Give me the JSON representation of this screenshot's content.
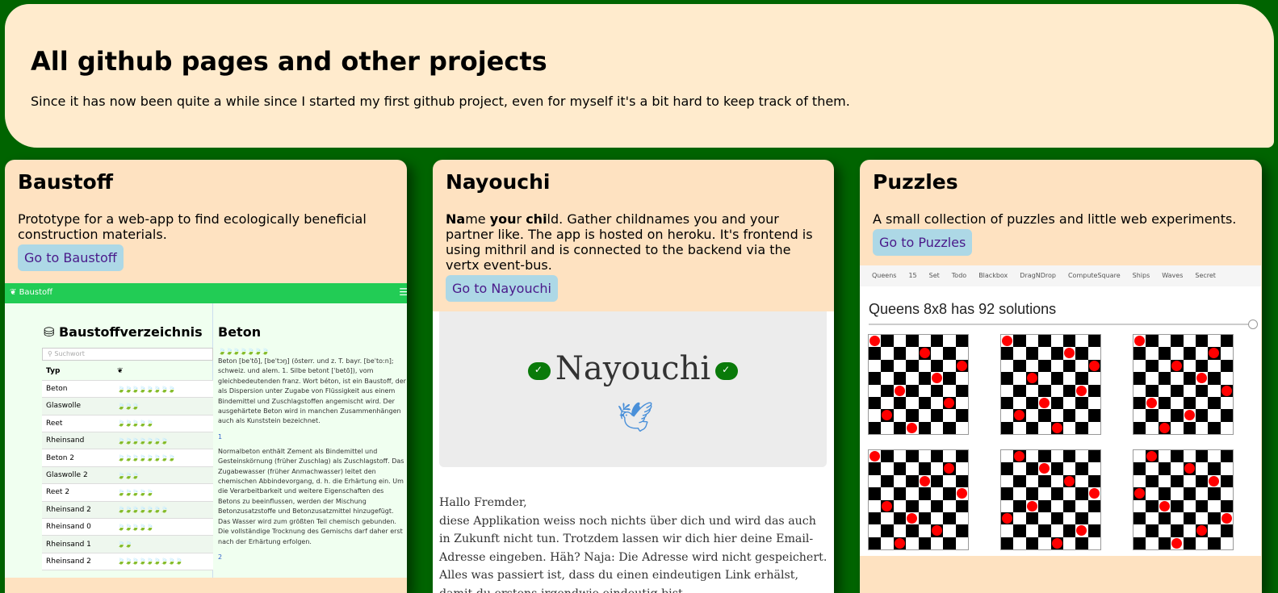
{
  "header": {
    "title": "All github pages and other projects",
    "subtitle": "Since it has now been quite a while since I started my first github project, even for myself it's a bit hard to keep track of them."
  },
  "cards": {
    "baustoff": {
      "title": "Baustoff",
      "description": "Prototype for a web-app to find ecologically beneficial construction materials.",
      "button": "Go to Baustoff",
      "preview": {
        "nav_title": "Baustoff",
        "heading": "Baustoffverzeichnis",
        "search_placeholder": "Suchwort",
        "col_type": "Typ",
        "rows": [
          {
            "name": "Beton",
            "leaves": "🍃🍃🍃🍃🍃🍃🍃🍃",
            "color": "#22aa33"
          },
          {
            "name": "Glaswolle",
            "leaves": "🍃🍃🍃",
            "color": "#ee3344"
          },
          {
            "name": "Reet",
            "leaves": "🍃🍃🍃🍃🍃",
            "color": "#ddcc22"
          },
          {
            "name": "Rheinsand",
            "leaves": "🍃🍃🍃🍃🍃🍃🍃",
            "color": "#3366dd"
          },
          {
            "name": "Beton 2",
            "leaves": "🍃🍃🍃🍃🍃🍃🍃🍃",
            "color": "#22aa33"
          },
          {
            "name": "Glaswolle 2",
            "leaves": "🍃🍃🍃",
            "color": "#ee3344"
          },
          {
            "name": "Reet 2",
            "leaves": "🍃🍃🍃🍃🍃",
            "color": "#ddcc22"
          },
          {
            "name": "Rheinsand 2",
            "leaves": "🍃🍃🍃🍃🍃🍃🍃",
            "color": "#3366dd"
          },
          {
            "name": "Rheinsand 0",
            "leaves": "🍃🍃🍃🍃🍃",
            "color": "#ddcc22"
          },
          {
            "name": "Rheinsand 1",
            "leaves": "🍃🍃",
            "color": "#ee3344"
          },
          {
            "name": "Rheinsand 2",
            "leaves": "🍃🍃🍃🍃🍃🍃🍃🍃🍃",
            "color": "#22aa33"
          }
        ],
        "detail_title": "Beton",
        "detail_leaves": "🍃🍃🍃🍃🍃🍃🍃",
        "detail_text1": "Beton [beˈtõ], [beˈtɔŋ] (österr. und z. T. bayr. [beˈtoːn]; schweiz. und alem. 1. Silbe betont [ˈbetõ]), vom gleichbedeutenden franz. Wort béton, ist ein Baustoff, der als Dispersion unter Zugabe von Flüssigkeit aus einem Bindemittel und Zuschlagstoffen angemischt wird. Der ausgehärtete Beton wird in manchen Zusammenhängen auch als Kunststein bezeichnet.",
        "link1": "1",
        "detail_text2": "Normalbeton enthält Zement als Bindemittel und Gesteinskörnung (früher Zuschlag) als Zuschlagstoff. Das Zugabewasser (früher Anmachwasser) leitet den chemischen Abbindevorgang, d. h. die Erhärtung ein. Um die Verarbeitbarkeit und weitere Eigenschaften des Betons zu beeinflussen, werden der Mischung Betonzusatzstoffe und Betonzusatzmittel hinzugefügt. Das Wasser wird zum größten Teil chemisch gebunden. Die vollständige Trocknung des Gemischs darf daher erst nach der Erhärtung erfolgen.",
        "link2": "2"
      }
    },
    "nayouchi": {
      "title": "Nayouchi",
      "desc_b1": "Na",
      "desc_t1": "me ",
      "desc_b2": "you",
      "desc_t2": "r ",
      "desc_b3": "chi",
      "desc_t3": "ld. Gather childnames you and your partner like. The app is hosted on heroku. It's frontend is using mithril and is connected to the backend via the vertx event-bus.",
      "button": "Go to Nayouchi",
      "preview": {
        "logo": "Nayouchi",
        "text": "Hallo Fremder,\ndiese Applikation weiss noch nichts über dich und wird das auch in Zukunft nicht tun. Trotzdem lassen wir dich hier deine Email-Adresse eingeben. Häh? Naja: Die Adresse wird nicht gespeichert. Alles was passiert ist, dass du einen eindeutigen Link erhälst, damit du erstens irgendwie eindeutig bist"
      }
    },
    "puzzles": {
      "title": "Puzzles",
      "description": "A small collection of puzzles and little web experiments.",
      "button": "Go to Puzzles",
      "preview": {
        "nav": [
          "Queens",
          "15",
          "Set",
          "Todo",
          "Blackbox",
          "DragNDrop",
          "ComputeSquare",
          "Ships",
          "Waves",
          "Secret"
        ],
        "heading": "Queens 8x8 has 92 solutions",
        "boards": [
          [
            0,
            4,
            7,
            5,
            2,
            6,
            1,
            3
          ],
          [
            0,
            5,
            7,
            2,
            6,
            3,
            1,
            4
          ],
          [
            0,
            6,
            3,
            5,
            7,
            1,
            4,
            2
          ],
          [
            0,
            6,
            4,
            7,
            1,
            3,
            5,
            2
          ],
          [
            1,
            3,
            5,
            7,
            2,
            0,
            6,
            4
          ],
          [
            1,
            4,
            6,
            0,
            2,
            7,
            5,
            3
          ]
        ]
      }
    }
  },
  "colors": {
    "background": "#006400",
    "header_bg": "#ffebcd",
    "card_bg": "#fee2c1",
    "button_bg": "#add8e6"
  }
}
